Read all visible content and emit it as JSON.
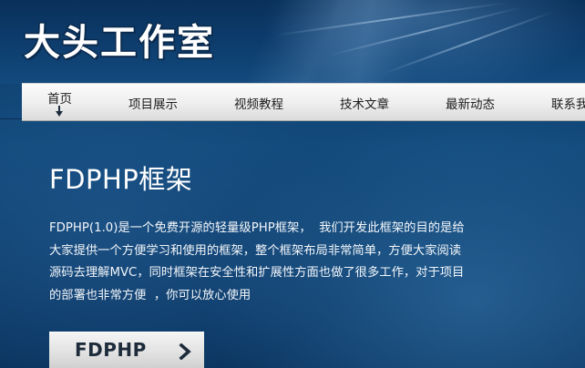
{
  "header": {
    "logo_text": "大头工作室"
  },
  "nav": {
    "items": [
      {
        "label": "首页",
        "active": true
      },
      {
        "label": "项目展示",
        "active": false
      },
      {
        "label": "视频教程",
        "active": false
      },
      {
        "label": "技术文章",
        "active": false
      },
      {
        "label": "最新动态",
        "active": false
      },
      {
        "label": "联系我",
        "active": false
      }
    ],
    "active_indicator_icon": "arrow-down-icon"
  },
  "main": {
    "title": "FDPHP框架",
    "description": "FDPHP(1.0)是一个免费开源的轻量级PHP框架，  我们开发此框架的目的是给大家提供一个方便学习和使用的框架，整个框架布局非常简单，方便大家阅读源码去理解MVC，同时框架在安全性和扩展性方面也做了很多工作，对于项目的部署也非常方便  ，你可以放心使用",
    "description_lines": [
      "FDPHP(1.0)是一个免费开源的轻量级PHP框架，  我们开发此框架的目的是给",
      "大家提供一个方便学习和使用的框架，整个框架布局非常简单，方便大家阅读",
      "源码去理解MVC，同时框架在安全性和扩展性方面也做了很多工作，对于项目",
      "的部署也非常方便  ，你可以放心使用"
    ],
    "cta": {
      "label": "FDPHP",
      "icon": "chevron-right-icon"
    }
  },
  "colors": {
    "background": "#124a7c",
    "header": "#0e3f70",
    "nav_bar": "#eeeeee",
    "text_light": "#ffffff",
    "text_dark": "#1c1c1c"
  }
}
